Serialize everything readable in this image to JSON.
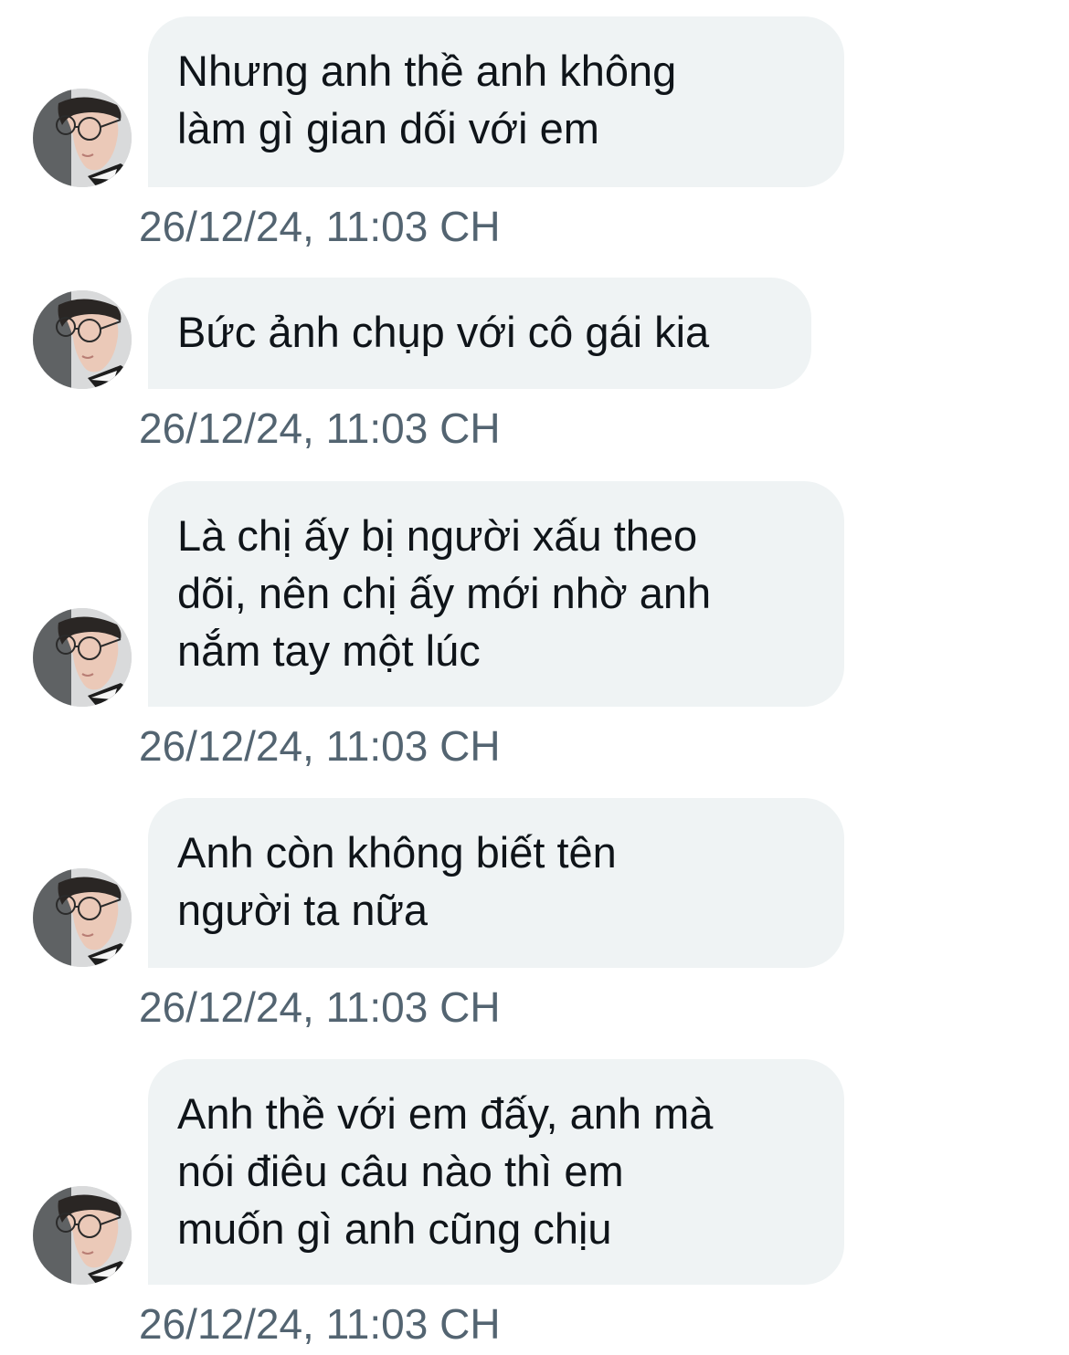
{
  "messages": [
    {
      "lines": [
        "Nhưng anh thề anh không",
        "làm gì gian dối với em"
      ],
      "timestamp": "26/12/24, 11:03 CH"
    },
    {
      "lines": [
        "Bức ảnh chụp với cô gái kia"
      ],
      "timestamp": "26/12/24, 11:03 CH"
    },
    {
      "lines": [
        "Là chị ấy bị người xấu theo",
        "dõi, nên chị ấy mới nhờ anh",
        "nắm tay một lúc"
      ],
      "timestamp": "26/12/24, 11:03 CH"
    },
    {
      "lines": [
        "Anh còn không biết tên",
        "người ta nữa"
      ],
      "timestamp": "26/12/24, 11:03 CH"
    },
    {
      "lines": [
        "Anh thề với em đấy, anh mà",
        "nói điêu câu nào thì em",
        "muốn gì anh cũng chịu"
      ],
      "timestamp": "26/12/24, 11:03 CH"
    }
  ],
  "colors": {
    "bubble_background": "#eff3f4",
    "message_text": "#0f1419",
    "timestamp_text": "#536471",
    "page_background": "#ffffff"
  },
  "icons": {
    "avatar": "sender-profile-photo"
  }
}
